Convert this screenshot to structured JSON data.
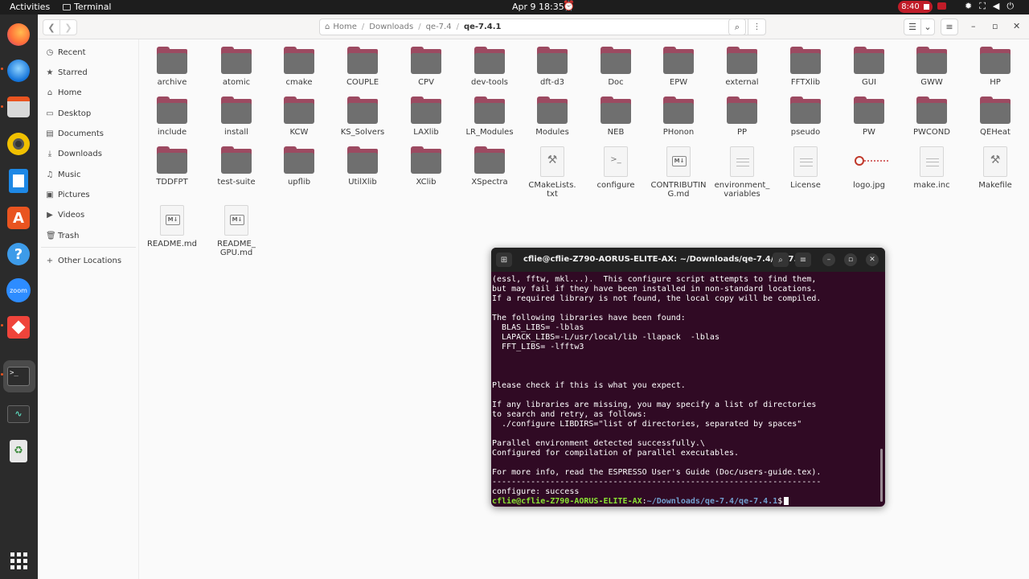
{
  "topbar": {
    "activities": "Activities",
    "app_name": "Terminal",
    "clock": "Apr 9  18:35",
    "record_time": "8:40"
  },
  "dock": {
    "items": [
      "firefox-icon",
      "thunderbird-icon",
      "files-icon",
      "rhythmbox-icon",
      "writer-icon",
      "software-icon",
      "help-icon",
      "zoom-icon",
      "anydesk-icon",
      "terminal-icon",
      "system-monitor-icon",
      "trash-icon",
      "show-apps-icon"
    ],
    "zoom_label": "zoom"
  },
  "fm": {
    "path": [
      "Home",
      "Downloads",
      "qe-7.4",
      "qe-7.4.1"
    ],
    "sidebar": [
      {
        "label": "Recent",
        "icon": "clock-icon"
      },
      {
        "label": "Starred",
        "icon": "star-icon"
      },
      {
        "label": "Home",
        "icon": "home-icon"
      },
      {
        "label": "Desktop",
        "icon": "desktop-icon"
      },
      {
        "label": "Documents",
        "icon": "document-icon"
      },
      {
        "label": "Downloads",
        "icon": "download-icon"
      },
      {
        "label": "Music",
        "icon": "music-icon"
      },
      {
        "label": "Pictures",
        "icon": "picture-icon"
      },
      {
        "label": "Videos",
        "icon": "video-icon"
      },
      {
        "label": "Trash",
        "icon": "trash-icon"
      },
      {
        "label": "Other Locations",
        "icon": "plus-icon"
      }
    ],
    "items": [
      {
        "name": "archive",
        "type": "folder"
      },
      {
        "name": "atomic",
        "type": "folder"
      },
      {
        "name": "cmake",
        "type": "folder"
      },
      {
        "name": "COUPLE",
        "type": "folder"
      },
      {
        "name": "CPV",
        "type": "folder"
      },
      {
        "name": "dev-tools",
        "type": "folder"
      },
      {
        "name": "dft-d3",
        "type": "folder"
      },
      {
        "name": "Doc",
        "type": "folder"
      },
      {
        "name": "EPW",
        "type": "folder"
      },
      {
        "name": "external",
        "type": "folder"
      },
      {
        "name": "FFTXlib",
        "type": "folder"
      },
      {
        "name": "GUI",
        "type": "folder"
      },
      {
        "name": "GWW",
        "type": "folder"
      },
      {
        "name": "HP",
        "type": "folder"
      },
      {
        "name": "include",
        "type": "folder"
      },
      {
        "name": "install",
        "type": "folder"
      },
      {
        "name": "KCW",
        "type": "folder"
      },
      {
        "name": "KS_Solvers",
        "type": "folder"
      },
      {
        "name": "LAXlib",
        "type": "folder"
      },
      {
        "name": "LR_Modules",
        "type": "folder"
      },
      {
        "name": "Modules",
        "type": "folder"
      },
      {
        "name": "NEB",
        "type": "folder"
      },
      {
        "name": "PHonon",
        "type": "folder"
      },
      {
        "name": "PP",
        "type": "folder"
      },
      {
        "name": "pseudo",
        "type": "folder"
      },
      {
        "name": "PW",
        "type": "folder"
      },
      {
        "name": "PWCOND",
        "type": "folder"
      },
      {
        "name": "QEHeat",
        "type": "folder"
      },
      {
        "name": "TDDFPT",
        "type": "folder"
      },
      {
        "name": "test-suite",
        "type": "folder"
      },
      {
        "name": "upflib",
        "type": "folder"
      },
      {
        "name": "UtilXlib",
        "type": "folder"
      },
      {
        "name": "XClib",
        "type": "folder"
      },
      {
        "name": "XSpectra",
        "type": "folder"
      },
      {
        "name": "CMakeLists.\ntxt",
        "type": "build"
      },
      {
        "name": "configure",
        "type": "script"
      },
      {
        "name": "CONTRIBUTIN\nG.md",
        "type": "markdown"
      },
      {
        "name": "environment_\nvariables",
        "type": "text"
      },
      {
        "name": "License",
        "type": "text"
      },
      {
        "name": "logo.jpg",
        "type": "image"
      },
      {
        "name": "make.inc",
        "type": "text"
      },
      {
        "name": "Makefile",
        "type": "build"
      },
      {
        "name": "README.md",
        "type": "markdown"
      },
      {
        "name": "README_\nGPU.md",
        "type": "markdown"
      }
    ]
  },
  "terminal": {
    "title": "cflie@cflie-Z790-AORUS-ELITE-AX: ~/Downloads/qe-7.4/qe-7...",
    "lines": [
      "(essl, fftw, mkl...).  This configure script attempts to find them,",
      "but may fail if they have been installed in non-standard locations.",
      "If a required library is not found, the local copy will be compiled.",
      "",
      "The following libraries have been found:",
      "  BLAS_LIBS= -lblas",
      "  LAPACK_LIBS=-L/usr/local/lib -llapack  -lblas",
      "  FFT_LIBS= -lfftw3",
      "",
      "",
      "",
      "Please check if this is what you expect.",
      "",
      "If any libraries are missing, you may specify a list of directories",
      "to search and retry, as follows:",
      "  ./configure LIBDIRS=\"list of directories, separated by spaces\"",
      "",
      "Parallel environment detected successfully.\\",
      "Configured for compilation of parallel executables.",
      "",
      "For more info, read the ESPRESSO User's Guide (Doc/users-guide.tex).",
      "--------------------------------------------------------------------",
      "configure: success"
    ],
    "prompt_user": "cflie@cflie-Z790-AORUS-ELITE-AX",
    "prompt_path": "~/Downloads/qe-7.4/qe-7.4.1",
    "prompt_suffix": "$"
  }
}
